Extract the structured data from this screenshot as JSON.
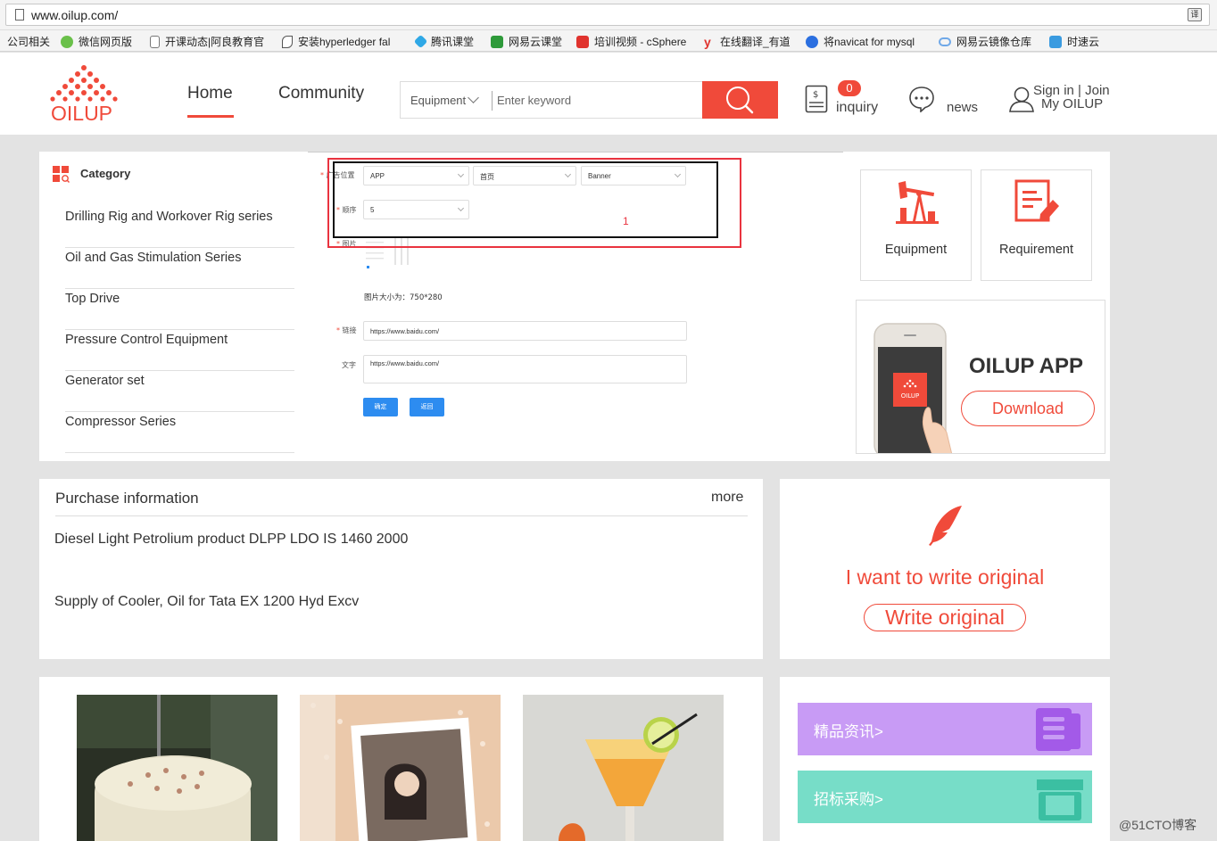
{
  "browser": {
    "url": "www.oilup.com/",
    "bookmarks": [
      {
        "label": "公司相关",
        "icon": "folder-icon"
      },
      {
        "label": "微信网页版",
        "icon": "wechat-icon"
      },
      {
        "label": "开课动态|阿良教育官",
        "icon": "page-icon"
      },
      {
        "label": "安装hyperledger fal",
        "icon": "link-icon"
      },
      {
        "label": "腾讯课堂",
        "icon": "tencent-icon"
      },
      {
        "label": "网易云课堂",
        "icon": "netease-icon"
      },
      {
        "label": "培训视频 - cSphere",
        "icon": "csphere-icon"
      },
      {
        "label": "在线翻译_有道",
        "icon": "youdao-icon"
      },
      {
        "label": "将navicat for mysql",
        "icon": "baidu-icon"
      },
      {
        "label": "网易云镜像仓库",
        "icon": "cloud-icon"
      },
      {
        "label": "时速云",
        "icon": "tenxcloud-icon"
      }
    ]
  },
  "header": {
    "logo_text": "OILUP",
    "nav": {
      "home": "Home",
      "community": "Community"
    },
    "search": {
      "category": "Equipment",
      "placeholder": "Enter keyword"
    },
    "inquiry": {
      "count": "0",
      "label": "inquiry"
    },
    "news_label": "news",
    "signin": "Sign in | Join",
    "my_oilup": "My OILUP"
  },
  "category": {
    "title": "Category",
    "items": [
      "Drilling Rig and Workover Rig series",
      "Oil and Gas Stimulation Series",
      "Top Drive",
      "Pressure Control Equipment",
      "Generator set",
      "Compressor Series"
    ]
  },
  "form_screenshot": {
    "label_position": "广告位置",
    "select_app": "APP",
    "select_home": "首页",
    "select_banner": "Banner",
    "label_order": "顺序",
    "order_value": "5",
    "label_image": "图片",
    "image_size_note": "图片大小为：750*280",
    "label_link": "链接",
    "link_value": "https://www.baidu.com/",
    "label_text": "文字",
    "text_value": "https://www.baidu.com/",
    "btn_confirm": "确定",
    "btn_back": "返回",
    "annotation_number": "1"
  },
  "quick_cards": {
    "equipment": "Equipment",
    "requirement": "Requirement"
  },
  "app_card": {
    "title": "OILUP APP",
    "download": "Download",
    "phone_logo": "OILUP"
  },
  "purchase": {
    "title": "Purchase information",
    "more": "more",
    "items": [
      "Diesel Light Petrolium product DLPP LDO IS 1460 2000",
      "Supply of Cooler, Oil for Tata EX 1200 Hyd Excv"
    ]
  },
  "write": {
    "title": "I want to write original",
    "button": "Write original"
  },
  "side_links": {
    "news": {
      "label": "精品资讯>",
      "color": "#c89bf5"
    },
    "tender": {
      "label": "招标采购>",
      "color": "#77ddc8"
    }
  },
  "watermark": "@51CTO博客",
  "colors": {
    "accent": "#f04a3a"
  }
}
